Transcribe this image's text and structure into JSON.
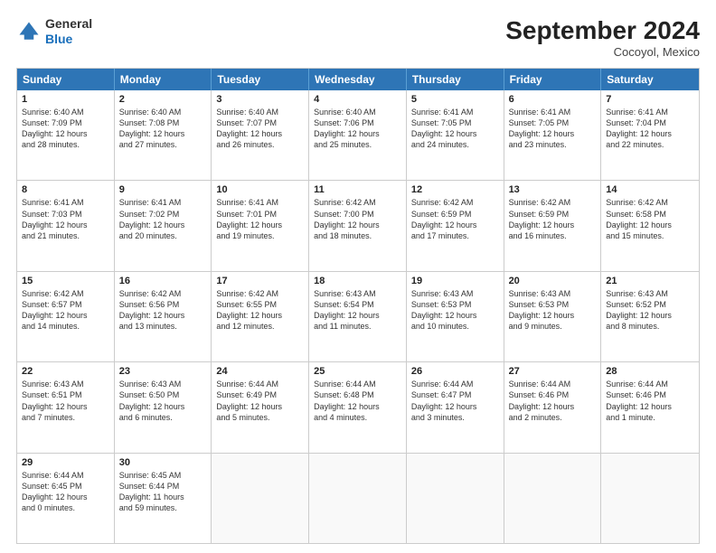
{
  "logo": {
    "general": "General",
    "blue": "Blue"
  },
  "title": "September 2024",
  "subtitle": "Cocoyol, Mexico",
  "header_days": [
    "Sunday",
    "Monday",
    "Tuesday",
    "Wednesday",
    "Thursday",
    "Friday",
    "Saturday"
  ],
  "rows": [
    [
      {
        "day": "1",
        "lines": [
          "Sunrise: 6:40 AM",
          "Sunset: 7:09 PM",
          "Daylight: 12 hours",
          "and 28 minutes."
        ]
      },
      {
        "day": "2",
        "lines": [
          "Sunrise: 6:40 AM",
          "Sunset: 7:08 PM",
          "Daylight: 12 hours",
          "and 27 minutes."
        ]
      },
      {
        "day": "3",
        "lines": [
          "Sunrise: 6:40 AM",
          "Sunset: 7:07 PM",
          "Daylight: 12 hours",
          "and 26 minutes."
        ]
      },
      {
        "day": "4",
        "lines": [
          "Sunrise: 6:40 AM",
          "Sunset: 7:06 PM",
          "Daylight: 12 hours",
          "and 25 minutes."
        ]
      },
      {
        "day": "5",
        "lines": [
          "Sunrise: 6:41 AM",
          "Sunset: 7:05 PM",
          "Daylight: 12 hours",
          "and 24 minutes."
        ]
      },
      {
        "day": "6",
        "lines": [
          "Sunrise: 6:41 AM",
          "Sunset: 7:05 PM",
          "Daylight: 12 hours",
          "and 23 minutes."
        ]
      },
      {
        "day": "7",
        "lines": [
          "Sunrise: 6:41 AM",
          "Sunset: 7:04 PM",
          "Daylight: 12 hours",
          "and 22 minutes."
        ]
      }
    ],
    [
      {
        "day": "8",
        "lines": [
          "Sunrise: 6:41 AM",
          "Sunset: 7:03 PM",
          "Daylight: 12 hours",
          "and 21 minutes."
        ]
      },
      {
        "day": "9",
        "lines": [
          "Sunrise: 6:41 AM",
          "Sunset: 7:02 PM",
          "Daylight: 12 hours",
          "and 20 minutes."
        ]
      },
      {
        "day": "10",
        "lines": [
          "Sunrise: 6:41 AM",
          "Sunset: 7:01 PM",
          "Daylight: 12 hours",
          "and 19 minutes."
        ]
      },
      {
        "day": "11",
        "lines": [
          "Sunrise: 6:42 AM",
          "Sunset: 7:00 PM",
          "Daylight: 12 hours",
          "and 18 minutes."
        ]
      },
      {
        "day": "12",
        "lines": [
          "Sunrise: 6:42 AM",
          "Sunset: 6:59 PM",
          "Daylight: 12 hours",
          "and 17 minutes."
        ]
      },
      {
        "day": "13",
        "lines": [
          "Sunrise: 6:42 AM",
          "Sunset: 6:59 PM",
          "Daylight: 12 hours",
          "and 16 minutes."
        ]
      },
      {
        "day": "14",
        "lines": [
          "Sunrise: 6:42 AM",
          "Sunset: 6:58 PM",
          "Daylight: 12 hours",
          "and 15 minutes."
        ]
      }
    ],
    [
      {
        "day": "15",
        "lines": [
          "Sunrise: 6:42 AM",
          "Sunset: 6:57 PM",
          "Daylight: 12 hours",
          "and 14 minutes."
        ]
      },
      {
        "day": "16",
        "lines": [
          "Sunrise: 6:42 AM",
          "Sunset: 6:56 PM",
          "Daylight: 12 hours",
          "and 13 minutes."
        ]
      },
      {
        "day": "17",
        "lines": [
          "Sunrise: 6:42 AM",
          "Sunset: 6:55 PM",
          "Daylight: 12 hours",
          "and 12 minutes."
        ]
      },
      {
        "day": "18",
        "lines": [
          "Sunrise: 6:43 AM",
          "Sunset: 6:54 PM",
          "Daylight: 12 hours",
          "and 11 minutes."
        ]
      },
      {
        "day": "19",
        "lines": [
          "Sunrise: 6:43 AM",
          "Sunset: 6:53 PM",
          "Daylight: 12 hours",
          "and 10 minutes."
        ]
      },
      {
        "day": "20",
        "lines": [
          "Sunrise: 6:43 AM",
          "Sunset: 6:53 PM",
          "Daylight: 12 hours",
          "and 9 minutes."
        ]
      },
      {
        "day": "21",
        "lines": [
          "Sunrise: 6:43 AM",
          "Sunset: 6:52 PM",
          "Daylight: 12 hours",
          "and 8 minutes."
        ]
      }
    ],
    [
      {
        "day": "22",
        "lines": [
          "Sunrise: 6:43 AM",
          "Sunset: 6:51 PM",
          "Daylight: 12 hours",
          "and 7 minutes."
        ]
      },
      {
        "day": "23",
        "lines": [
          "Sunrise: 6:43 AM",
          "Sunset: 6:50 PM",
          "Daylight: 12 hours",
          "and 6 minutes."
        ]
      },
      {
        "day": "24",
        "lines": [
          "Sunrise: 6:44 AM",
          "Sunset: 6:49 PM",
          "Daylight: 12 hours",
          "and 5 minutes."
        ]
      },
      {
        "day": "25",
        "lines": [
          "Sunrise: 6:44 AM",
          "Sunset: 6:48 PM",
          "Daylight: 12 hours",
          "and 4 minutes."
        ]
      },
      {
        "day": "26",
        "lines": [
          "Sunrise: 6:44 AM",
          "Sunset: 6:47 PM",
          "Daylight: 12 hours",
          "and 3 minutes."
        ]
      },
      {
        "day": "27",
        "lines": [
          "Sunrise: 6:44 AM",
          "Sunset: 6:46 PM",
          "Daylight: 12 hours",
          "and 2 minutes."
        ]
      },
      {
        "day": "28",
        "lines": [
          "Sunrise: 6:44 AM",
          "Sunset: 6:46 PM",
          "Daylight: 12 hours",
          "and 1 minute."
        ]
      }
    ],
    [
      {
        "day": "29",
        "lines": [
          "Sunrise: 6:44 AM",
          "Sunset: 6:45 PM",
          "Daylight: 12 hours",
          "and 0 minutes."
        ]
      },
      {
        "day": "30",
        "lines": [
          "Sunrise: 6:45 AM",
          "Sunset: 6:44 PM",
          "Daylight: 11 hours",
          "and 59 minutes."
        ]
      },
      {
        "day": "",
        "lines": []
      },
      {
        "day": "",
        "lines": []
      },
      {
        "day": "",
        "lines": []
      },
      {
        "day": "",
        "lines": []
      },
      {
        "day": "",
        "lines": []
      }
    ]
  ]
}
